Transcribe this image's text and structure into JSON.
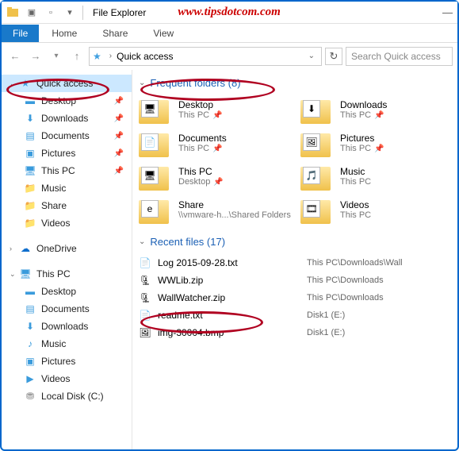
{
  "titlebar": {
    "title": "File Explorer",
    "watermark": "www.tipsdotcom.com"
  },
  "ribbon": {
    "file": "File",
    "tabs": [
      "Home",
      "Share",
      "View"
    ]
  },
  "addr": {
    "location": "Quick access",
    "searchPlaceholder": "Search Quick access"
  },
  "sidebar": {
    "quick": "Quick access",
    "quickItems": [
      {
        "label": "Desktop",
        "pin": true,
        "color": "#3a9bdc"
      },
      {
        "label": "Downloads",
        "pin": true,
        "color": "#3a9bdc"
      },
      {
        "label": "Documents",
        "pin": true,
        "color": "#3a9bdc"
      },
      {
        "label": "Pictures",
        "pin": true,
        "color": "#3a9bdc"
      },
      {
        "label": "This PC",
        "pin": true,
        "color": "#3a9bdc"
      },
      {
        "label": "Music",
        "pin": false,
        "color": "#f0c14b"
      },
      {
        "label": "Share",
        "pin": false,
        "color": "#f0c14b"
      },
      {
        "label": "Videos",
        "pin": false,
        "color": "#f0c14b"
      }
    ],
    "onedrive": "OneDrive",
    "thispc": "This PC",
    "pcItems": [
      "Desktop",
      "Documents",
      "Downloads",
      "Music",
      "Pictures",
      "Videos",
      "Local Disk (C:)"
    ]
  },
  "frequent": {
    "header": "Frequent folders (8)",
    "items": [
      {
        "name": "Desktop",
        "loc": "This PC",
        "pin": true,
        "overlay": "🖥"
      },
      {
        "name": "Downloads",
        "loc": "This PC",
        "pin": true,
        "overlay": "⬇"
      },
      {
        "name": "Documents",
        "loc": "This PC",
        "pin": true,
        "overlay": "📄"
      },
      {
        "name": "Pictures",
        "loc": "This PC",
        "pin": true,
        "overlay": "🖼"
      },
      {
        "name": "This PC",
        "loc": "Desktop",
        "pin": true,
        "overlay": "🖥"
      },
      {
        "name": "Music",
        "loc": "This PC",
        "pin": false,
        "overlay": "🎵"
      },
      {
        "name": "Share",
        "loc": "\\\\vmware-h...\\Shared Folders",
        "pin": false,
        "overlay": "e"
      },
      {
        "name": "Videos",
        "loc": "This PC",
        "pin": false,
        "overlay": "🎞"
      }
    ]
  },
  "recent": {
    "header": "Recent files (17)",
    "items": [
      {
        "name": "Log 2015-09-28.txt",
        "path": "This PC\\Downloads\\Wall",
        "ico": "📄"
      },
      {
        "name": "WWLib.zip",
        "path": "This PC\\Downloads",
        "ico": "🗜"
      },
      {
        "name": "WallWatcher.zip",
        "path": "This PC\\Downloads",
        "ico": "🗜"
      },
      {
        "name": "readme.txt",
        "path": "Disk1 (E:)",
        "ico": "📄"
      },
      {
        "name": "img-30004.bmp",
        "path": "Disk1 (E:)",
        "ico": "🖼"
      }
    ]
  }
}
